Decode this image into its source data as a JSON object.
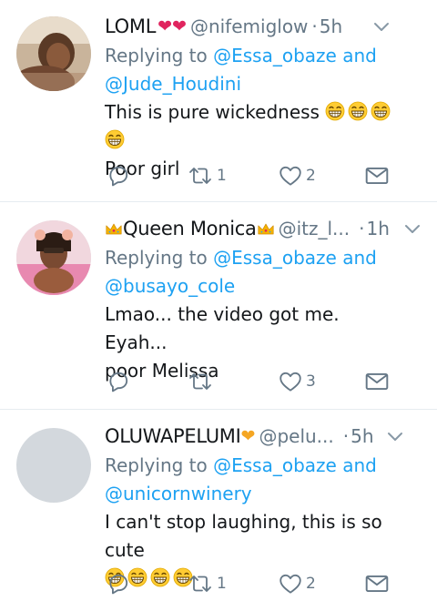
{
  "colors": {
    "link": "#1da1f2",
    "muted": "#657786",
    "text": "#14171a",
    "divider": "#e6ecf0"
  },
  "tweets": [
    {
      "name": "LOML",
      "name_suffix": "❤❤",
      "handle": "@nifemiglow",
      "time": "5h",
      "replying_prefix": "Replying to",
      "mentions": [
        "@Essa_obaze",
        "@Jude_Houdini"
      ],
      "and": "and",
      "text_line1": "This is pure wickedness",
      "text_line2": "Poor girl",
      "retweets": "1",
      "likes": "2"
    },
    {
      "name": "Queen Monica",
      "handle": "@itz_l...",
      "time": "1h",
      "replying_prefix": "Replying to",
      "mentions": [
        "@Essa_obaze",
        "@busayo_cole"
      ],
      "and": "and",
      "text_line1": "Lmao... the video got me. Eyah...",
      "text_line2": "poor Melissa",
      "retweets": "",
      "likes": "3"
    },
    {
      "name": "OLUWAPELUMI",
      "handle": "@pelu...",
      "time": "5h",
      "replying_prefix": "Replying to",
      "mentions": [
        "@Essa_obaze",
        "@unicornwinery"
      ],
      "and": "and",
      "text_line1": "I can't stop laughing, this is so cute",
      "retweets": "1",
      "likes": "2"
    }
  ],
  "icons": [
    "reply-icon",
    "retweet-icon",
    "like-icon",
    "message-icon",
    "caret-down-icon",
    "grin-emoji",
    "crown-emoji"
  ]
}
